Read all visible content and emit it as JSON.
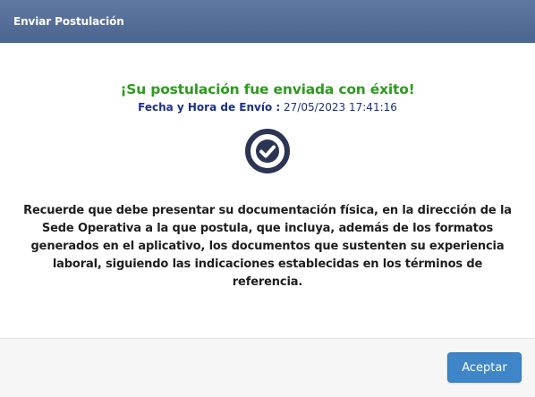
{
  "header": {
    "title": "Enviar Postulación"
  },
  "body": {
    "success_title": "¡Su postulación fue enviada con éxito!",
    "datetime_label": "Fecha y Hora de Envío :",
    "datetime_value": "27/05/2023 17:41:16",
    "check_icon": "check-circle-icon",
    "message": "Recuerde que debe presentar su documentación física, en la dirección de la Sede Operativa a la que postula, que incluya, además de los formatos generados en el aplicativo, los documentos que sustenten su experiencia laboral, siguiendo las indicaciones establecidas en los términos de referencia."
  },
  "footer": {
    "accept_label": "Aceptar"
  },
  "colors": {
    "header_bg": "#56709a",
    "success_green": "#2e9a1f",
    "datetime_blue": "#1c2f8c",
    "icon_navy": "#2c3554",
    "button_blue": "#3f86c9"
  }
}
